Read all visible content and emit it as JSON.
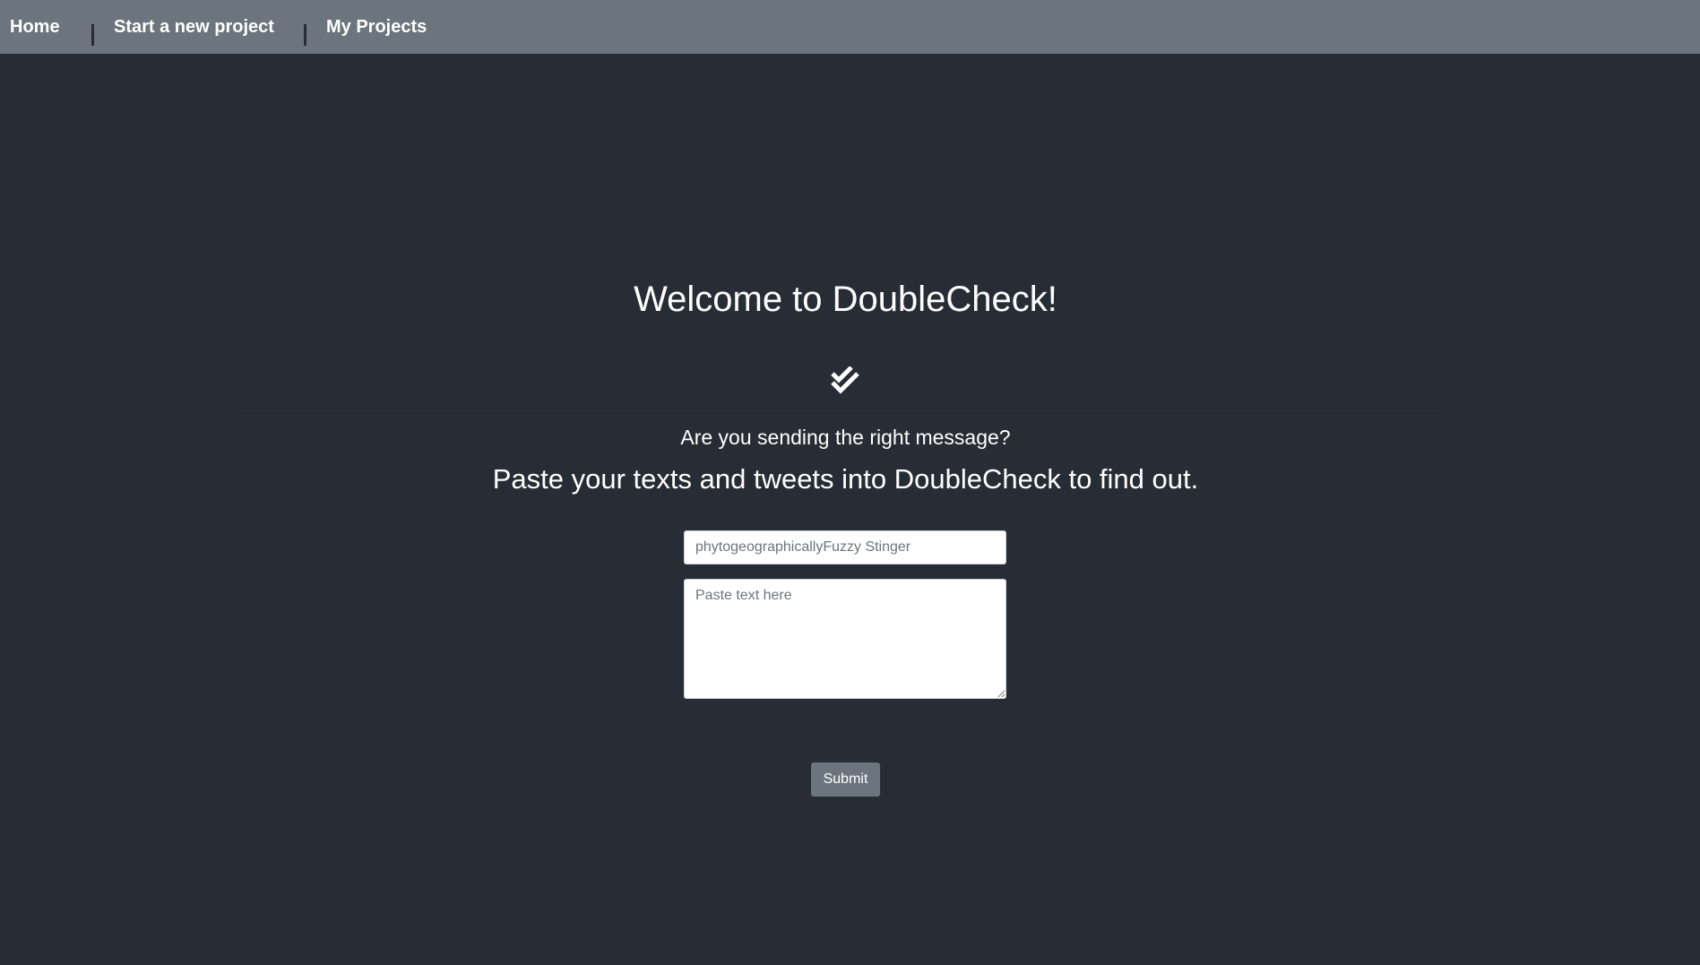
{
  "nav": {
    "items": [
      {
        "label": "Home"
      },
      {
        "label": "Start a new project"
      },
      {
        "label": "My Projects"
      }
    ]
  },
  "main": {
    "title": "Welcome to DoubleCheck!",
    "icon": "double-check-icon",
    "subtitle": "Are you sending the right message?",
    "lead": "Paste your texts and tweets into DoubleCheck to find out.",
    "name_field": {
      "value": "",
      "placeholder": "phytogeographicallyFuzzy Stinger"
    },
    "text_field": {
      "value": "",
      "placeholder": "Paste text here"
    },
    "submit_label": "Submit"
  },
  "colors": {
    "background": "#282c34",
    "navbar": "#6c757d",
    "button": "#6c757d",
    "text": "#ffffff"
  }
}
